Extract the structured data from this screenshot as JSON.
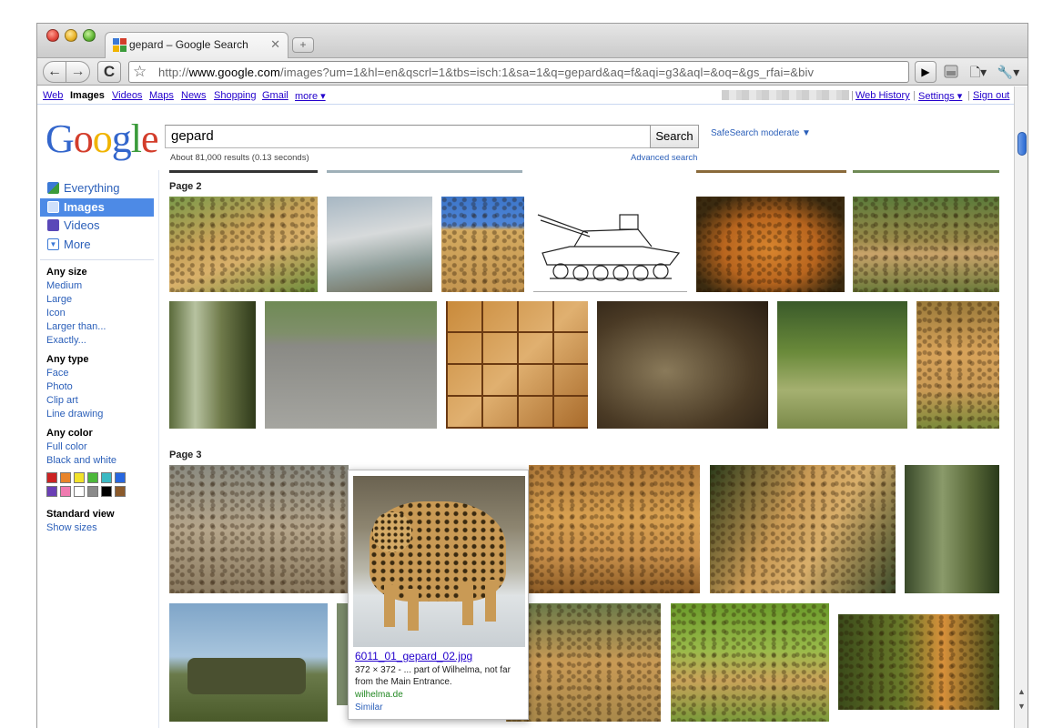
{
  "browser": {
    "tab_title": "gepard – Google Search",
    "tab_close": "✕",
    "new_tab": "+",
    "back": "←",
    "forward": "→",
    "reload": "C",
    "star": "☆",
    "url_prefix": "http://",
    "url_host": "www.google.com",
    "url_rest": "/images?um=1&hl=en&qscrl=1&tbs=isch:1&sa=1&q=gepard&aq=f&aqi=g3&aql=&oq=&gs_rfai=&biv",
    "go": "▶",
    "page_menu": "🗋▾",
    "wrench_menu": "🔧▾"
  },
  "gbar": {
    "links": [
      "Web",
      "Images",
      "Videos",
      "Maps",
      "News",
      "Shopping",
      "Gmail",
      "more ▾"
    ],
    "selected": "Images",
    "right_links": [
      "Web History",
      "Settings ▾",
      "Sign out"
    ]
  },
  "logo_letters": [
    "G",
    "o",
    "o",
    "g",
    "l",
    "e"
  ],
  "search": {
    "query": "gepard",
    "button": "Search",
    "safesearch": "SafeSearch moderate ▼",
    "result_stats": "About 81,000 results (0.13 seconds)",
    "advanced": "Advanced search"
  },
  "leftnav": {
    "items": [
      {
        "label": "Everything",
        "icon": "everything-icon",
        "active": false
      },
      {
        "label": "Images",
        "icon": "images-icon",
        "active": true
      },
      {
        "label": "Videos",
        "icon": "videos-icon",
        "active": false
      },
      {
        "label": "More",
        "icon": "more-icon",
        "active": false
      }
    ],
    "size_head": "Any size",
    "sizes": [
      "Medium",
      "Large",
      "Icon",
      "Larger than...",
      "Exactly..."
    ],
    "type_head": "Any type",
    "types": [
      "Face",
      "Photo",
      "Clip art",
      "Line drawing"
    ],
    "color_head": "Any color",
    "colors_links": [
      "Full color",
      "Black and white"
    ],
    "swatches": [
      "#cc2222",
      "#e8842a",
      "#f2e22a",
      "#4cb83a",
      "#3bb9c3",
      "#2767e0",
      "#6a3fb5",
      "#f07ab0",
      "#ffffff",
      "#8a8a8a",
      "#000000",
      "#8b5a2b"
    ],
    "view_head": "Standard view",
    "view_link": "Show sizes"
  },
  "results": {
    "page2_label": "Page 2",
    "page3_label": "Page 3"
  },
  "popup": {
    "filename": "6011_01_gepard_02.jpg",
    "description": "372 × 372 - ... part of Wilhelma, not far from the Main Entrance.",
    "site": "wilhelma.de",
    "similar": "Similar"
  },
  "colors": {
    "link": "#2b5fb9",
    "active_nav": "#4d8ae6"
  }
}
